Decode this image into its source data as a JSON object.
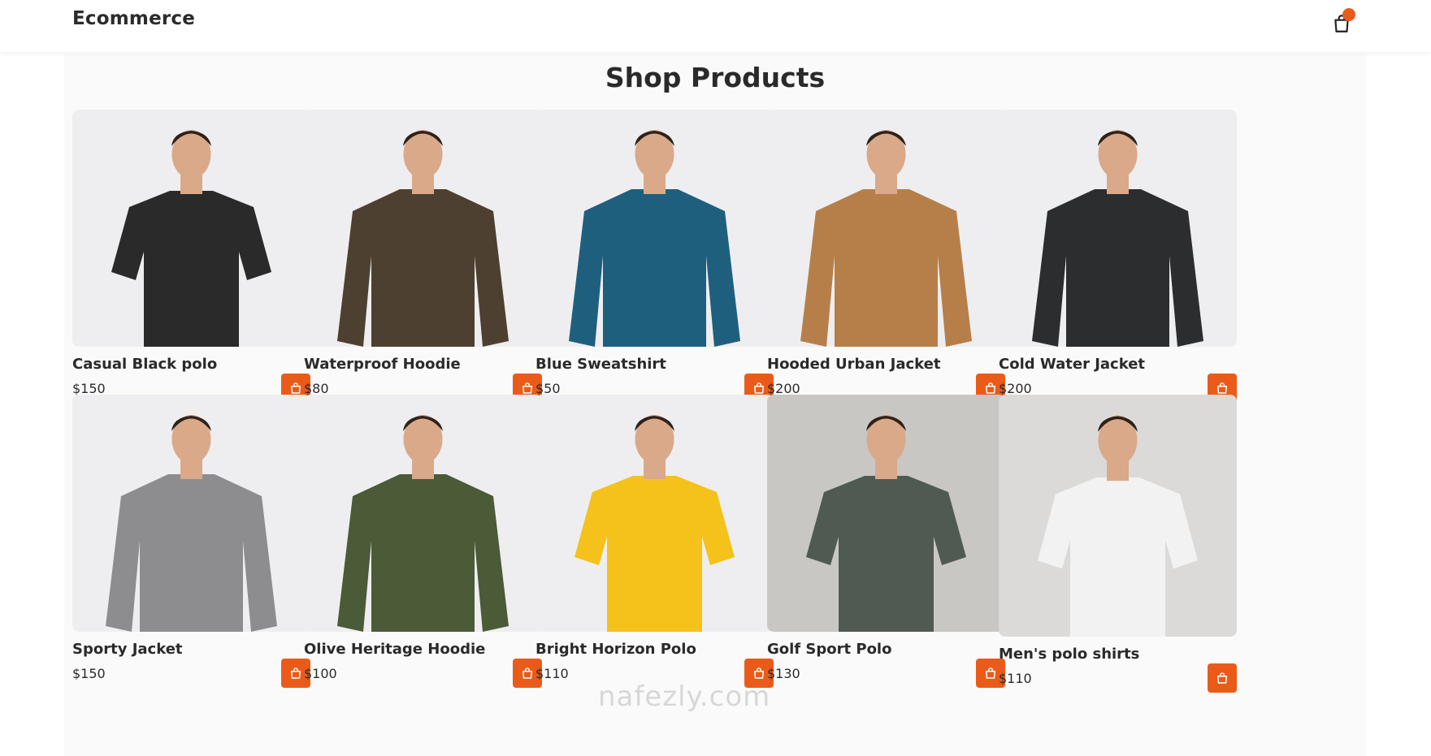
{
  "header": {
    "brand": "Ecommerce",
    "cart_icon": "shopping-bag-icon",
    "badge_color": "#ea5b1a"
  },
  "main": {
    "title": "Shop Products"
  },
  "theme": {
    "accent": "#ea5b1a",
    "card_bg": "#eeeef0"
  },
  "products": [
    {
      "name": "Casual Black polo",
      "price": "$150",
      "garment_color": "#2a2a2a"
    },
    {
      "name": "Waterproof Hoodie",
      "price": "$80",
      "garment_color": "#4d4030"
    },
    {
      "name": "Blue Sweatshirt",
      "price": "$50",
      "garment_color": "#1f5f7e"
    },
    {
      "name": "Hooded Urban Jacket",
      "price": "$200",
      "garment_color": "#b67f4a"
    },
    {
      "name": "Cold Water Jacket",
      "price": "$200",
      "garment_color": "#2b2d2f"
    },
    {
      "name": "Sporty Jacket",
      "price": "$150",
      "garment_color": "#8d8d90"
    },
    {
      "name": "Olive Heritage Hoodie",
      "price": "$100",
      "garment_color": "#4b5a37"
    },
    {
      "name": "Bright Horizon Polo",
      "price": "$110",
      "garment_color": "#f4c21a"
    },
    {
      "name": "Golf Sport Polo",
      "price": "$130",
      "garment_color": "#4f5a52"
    },
    {
      "name": "Men's polo shirts",
      "price": "$110",
      "garment_color": "#f2f2f2"
    }
  ],
  "watermark": "nafezly.com"
}
